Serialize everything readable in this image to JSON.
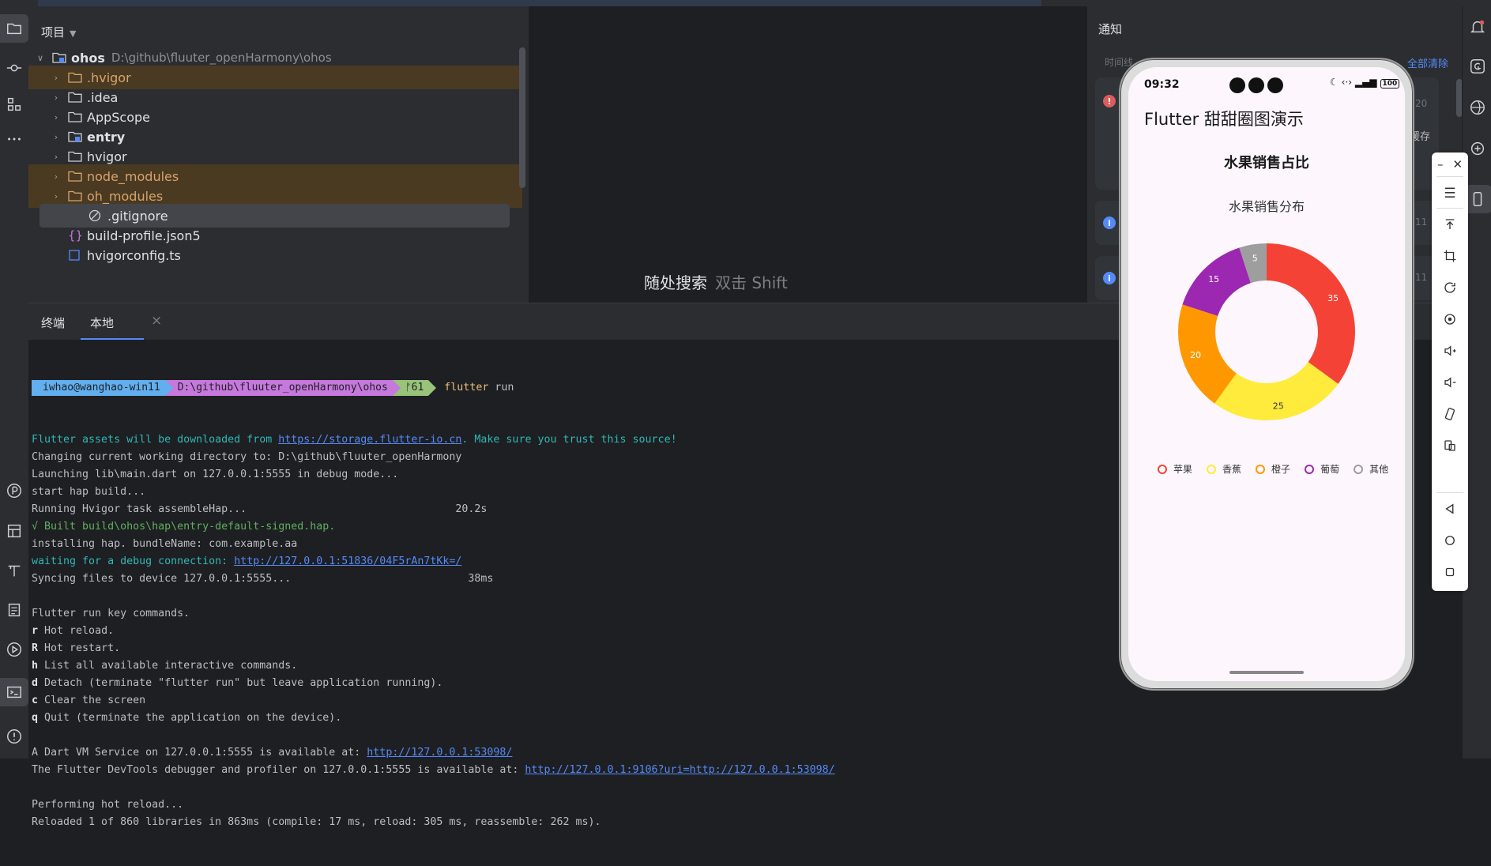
{
  "project_panel": {
    "title": "项目",
    "tree": [
      {
        "name": "ohos",
        "path": "D:\\github\\fluuter_openHarmony\\ohos",
        "type": "module-root",
        "expanded": true
      },
      {
        "name": ".hvigor",
        "type": "folder-excluded"
      },
      {
        "name": ".idea",
        "type": "folder"
      },
      {
        "name": "AppScope",
        "type": "folder"
      },
      {
        "name": "entry",
        "type": "module"
      },
      {
        "name": "hvigor",
        "type": "folder"
      },
      {
        "name": "node_modules",
        "type": "folder-excluded"
      },
      {
        "name": "oh_modules",
        "type": "folder-excluded"
      },
      {
        "name": ".gitignore",
        "type": "file-ignore"
      },
      {
        "name": "build-profile.json5",
        "type": "file-json"
      },
      {
        "name": "hvigorconfig.ts",
        "type": "file-ts"
      }
    ]
  },
  "center": {
    "search_hint": "随处搜索",
    "search_shortcut": "双击 Shift"
  },
  "notifications": {
    "title": "通知",
    "time_col": "时间线",
    "clear_all": "全部清除",
    "side_fragments": [
      "20",
      "缓存",
      "11",
      "11"
    ]
  },
  "terminal": {
    "tabs": [
      "终端",
      "本地"
    ],
    "prompt": {
      "user": "iwhao@wanghao-win11",
      "path": "D:\\github\\fluuter_openHarmony\\ohos",
      "branch": "61",
      "command": "flutter",
      "arg": "run"
    },
    "lines": [
      {
        "parts": [
          {
            "t": "Flutter assets will be downloaded from ",
            "c": "cyan"
          },
          {
            "t": "https://storage.flutter-io.cn",
            "c": "link"
          },
          {
            "t": ". Make sure you trust this source!",
            "c": "cyan"
          }
        ]
      },
      {
        "parts": [
          {
            "t": "Changing current working directory to: D:\\github\\fluuter_openHarmony"
          }
        ]
      },
      {
        "parts": [
          {
            "t": "Launching lib\\main.dart on 127.0.0.1:5555 in debug mode..."
          }
        ]
      },
      {
        "parts": [
          {
            "t": "start hap build..."
          }
        ]
      },
      {
        "parts": [
          {
            "t": "Running Hvigor task assembleHap...                                 20.2s"
          }
        ]
      },
      {
        "parts": [
          {
            "t": "√ Built build\\ohos\\hap\\entry-default-signed.hap.",
            "c": "green"
          }
        ]
      },
      {
        "parts": [
          {
            "t": "installing hap. bundleName: com.example.aa"
          }
        ]
      },
      {
        "parts": [
          {
            "t": "waiting for a debug connection: ",
            "c": "cyan"
          },
          {
            "t": "http://127.0.0.1:51836/04F5rAn7tKk=/",
            "c": "link"
          }
        ]
      },
      {
        "parts": [
          {
            "t": "Syncing files to device 127.0.0.1:5555...                            38ms"
          }
        ]
      },
      {
        "parts": [
          {
            "t": ""
          }
        ]
      },
      {
        "parts": [
          {
            "t": "Flutter run key commands."
          }
        ]
      },
      {
        "parts": [
          {
            "t": "r",
            "c": "kbold"
          },
          {
            "t": " Hot reload."
          }
        ]
      },
      {
        "parts": [
          {
            "t": "R",
            "c": "kbold"
          },
          {
            "t": " Hot restart."
          }
        ]
      },
      {
        "parts": [
          {
            "t": "h",
            "c": "kbold"
          },
          {
            "t": " List all available interactive commands."
          }
        ]
      },
      {
        "parts": [
          {
            "t": "d",
            "c": "kbold"
          },
          {
            "t": " Detach (terminate \"flutter run\" but leave application running)."
          }
        ]
      },
      {
        "parts": [
          {
            "t": "c",
            "c": "kbold"
          },
          {
            "t": " Clear the screen"
          }
        ]
      },
      {
        "parts": [
          {
            "t": "q",
            "c": "kbold"
          },
          {
            "t": " Quit (terminate the application on the device)."
          }
        ]
      },
      {
        "parts": [
          {
            "t": ""
          }
        ]
      },
      {
        "parts": [
          {
            "t": "A Dart VM Service on 127.0.0.1:5555 is available at: "
          },
          {
            "t": "http://127.0.0.1:53098/",
            "c": "link"
          }
        ]
      },
      {
        "parts": [
          {
            "t": "The Flutter DevTools debugger and profiler on 127.0.0.1:5555 is available at: "
          },
          {
            "t": "http://127.0.0.1:9106?uri=http://127.0.0.1:53098/",
            "c": "link"
          }
        ]
      },
      {
        "parts": [
          {
            "t": ""
          }
        ]
      },
      {
        "parts": [
          {
            "t": "Performing hot reload..."
          }
        ]
      },
      {
        "parts": [
          {
            "t": "Reloaded 1 of 860 libraries in 863ms (compile: 17 ms, reload: 305 ms, reassemble: 262 ms)."
          }
        ]
      }
    ]
  },
  "phone": {
    "time": "09:32",
    "battery": "100",
    "app_title": "Flutter 甜甜圈图演示",
    "card_title": "水果销售占比"
  },
  "chart_data": {
    "type": "pie",
    "title": "水果销售分布",
    "categories": [
      "苹果",
      "香蕉",
      "橙子",
      "葡萄",
      "其他"
    ],
    "values": [
      35,
      25,
      20,
      15,
      5
    ],
    "colors": [
      "#f44336",
      "#ffeb3b",
      "#ff9800",
      "#9c27b0",
      "#9e9e9e"
    ],
    "inner_radius_ratio": 0.58,
    "legend_position": "bottom"
  },
  "colors": {
    "accent": "#548af7",
    "excluded_folder": "#d8a36c",
    "error": "#db5c5c",
    "info": "#548af7"
  }
}
